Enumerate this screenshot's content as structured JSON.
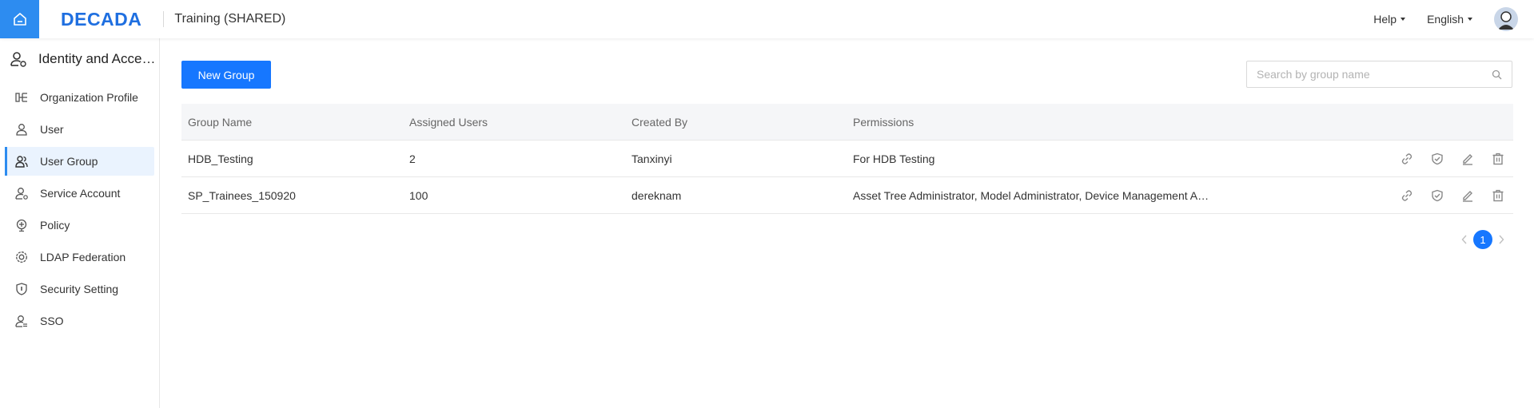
{
  "header": {
    "logo": "DECADA",
    "workspace": "Training (SHARED)",
    "help": "Help",
    "language": "English"
  },
  "sidebar": {
    "title": "Identity and Access Management",
    "items": [
      {
        "label": "Organization Profile",
        "icon": "org-chart-icon",
        "active": false
      },
      {
        "label": "User",
        "icon": "user-icon",
        "active": false
      },
      {
        "label": "User Group",
        "icon": "user-group-icon",
        "active": true
      },
      {
        "label": "Service Account",
        "icon": "service-account-icon",
        "active": false
      },
      {
        "label": "Policy",
        "icon": "policy-icon",
        "active": false
      },
      {
        "label": "LDAP Federation",
        "icon": "ldap-icon",
        "active": false
      },
      {
        "label": "Security Setting",
        "icon": "shield-icon",
        "active": false
      },
      {
        "label": "SSO",
        "icon": "sso-icon",
        "active": false
      }
    ]
  },
  "toolbar": {
    "new_group": "New Group",
    "search_placeholder": "Search by group name"
  },
  "table": {
    "columns": [
      "Group Name",
      "Assigned Users",
      "Created By",
      "Permissions"
    ],
    "rows": [
      {
        "group_name": "HDB_Testing",
        "assigned_users": "2",
        "created_by": "Tanxinyi",
        "permissions": "For HDB Testing"
      },
      {
        "group_name": "SP_Trainees_150920",
        "assigned_users": "100",
        "created_by": "dereknam",
        "permissions": "Asset Tree Administrator, Model Administrator, Device Management Administrator"
      }
    ],
    "row_actions": [
      "link-icon",
      "shield-check-icon",
      "edit-icon",
      "delete-icon"
    ]
  },
  "pagination": {
    "current_page": "1"
  },
  "colors": {
    "accent": "#1677ff",
    "home_bg": "#2d8cf0",
    "active_bg": "#eaf3fe"
  }
}
